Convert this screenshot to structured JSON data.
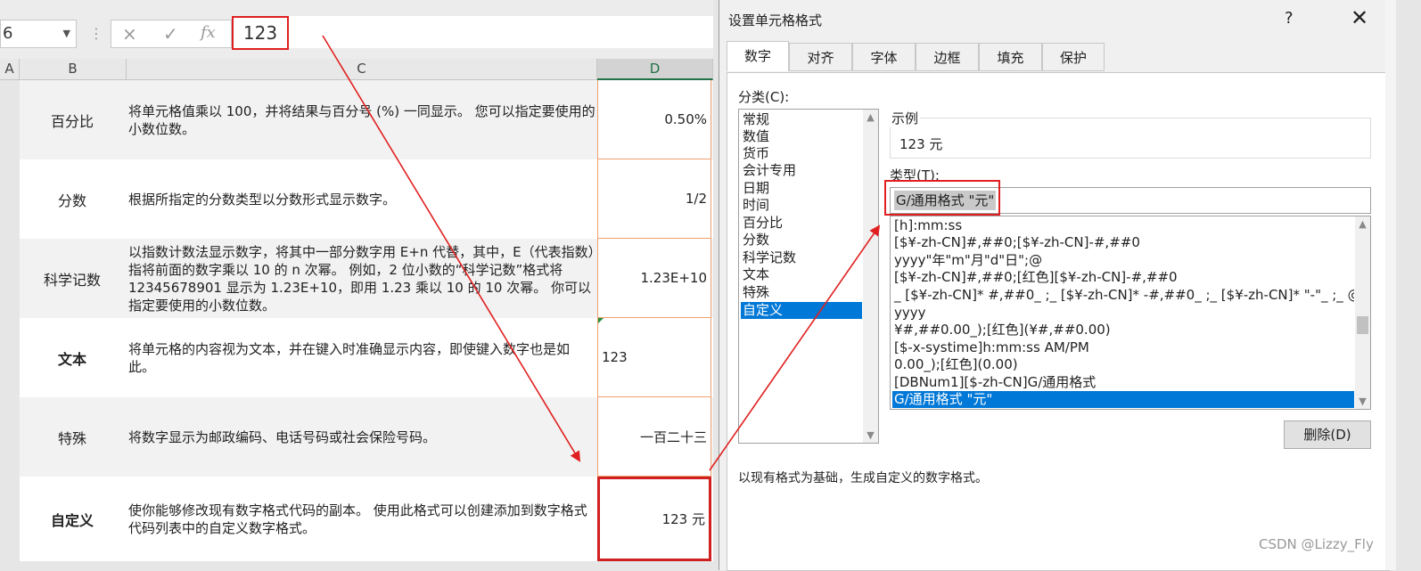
{
  "formula_bar": {
    "name_box": "6",
    "cancel_icon": "×",
    "enter_icon": "✓",
    "fx_label": "fx",
    "value": "123"
  },
  "columns": [
    "A",
    "B",
    "C",
    "D"
  ],
  "rows": [
    {
      "category": "百分比",
      "bold": false,
      "description": "将单元格值乘以 100，并将结果与百分号 (%) 一同显示。 您可以指定要使用的小数位数。",
      "value": "0.50%"
    },
    {
      "category": "分数",
      "bold": false,
      "description": "根据所指定的分数类型以分数形式显示数字。",
      "value": "1/2"
    },
    {
      "category": "科学记数",
      "bold": false,
      "description": "以指数计数法显示数字，将其中一部分数字用 E+n 代替，其中，E（代表指数）指将前面的数字乘以 10 的 n 次幂。 例如，2 位小数的“科学记数”格式将 12345678901 显示为 1.23E+10，即用 1.23 乘以 10 的 10 次幂。 你可以指定要使用的小数位数。",
      "value": "1.23E+10"
    },
    {
      "category": "文本",
      "bold": true,
      "description": "将单元格的内容视为文本，并在键入时准确显示内容，即使键入数字也是如此。",
      "value": "123"
    },
    {
      "category": "特殊",
      "bold": false,
      "description": "将数字显示为邮政编码、电话号码或社会保险号码。",
      "value": "一百二十三"
    },
    {
      "category": "自定义",
      "bold": true,
      "description": "使你能够修改现有数字格式代码的副本。 使用此格式可以创建添加到数字格式代码列表中的自定义数字格式。",
      "value": "123 元"
    }
  ],
  "dialog": {
    "title": "设置单元格格式",
    "help": "?",
    "close": "✕",
    "tabs": [
      "数字",
      "对齐",
      "字体",
      "边框",
      "填充",
      "保护"
    ],
    "active_tab": "数字",
    "category_label": "分类(C):",
    "categories": [
      "常规",
      "数值",
      "货币",
      "会计专用",
      "日期",
      "时间",
      "百分比",
      "分数",
      "科学记数",
      "文本",
      "特殊",
      "自定义"
    ],
    "selected_category": "自定义",
    "sample_label": "示例",
    "sample_value": "123 元",
    "type_label": "类型(T):",
    "type_value": "G/通用格式 \"元\"",
    "formats": [
      "[h]:mm:ss",
      "[$¥-zh-CN]#,##0;[$¥-zh-CN]-#,##0",
      "yyyy\"年\"m\"月\"d\"日\";@",
      "[$¥-zh-CN]#,##0;[红色][$¥-zh-CN]-#,##0",
      "_ [$¥-zh-CN]* #,##0_ ;_ [$¥-zh-CN]* -#,##0_ ;_ [$¥-zh-CN]* \"-\"_ ;_ @_",
      "yyyy",
      "¥#,##0.00_);[红色](¥#,##0.00)",
      "[$-x-systime]h:mm:ss AM/PM",
      "0.00_);[红色](0.00)",
      "[DBNum1][$-zh-CN]G/通用格式",
      "G/通用格式 \"元\""
    ],
    "selected_format": "G/通用格式 \"元\"",
    "delete_button": "删除(D)",
    "description": "以现有格式为基础，生成自定义的数字格式。"
  },
  "watermark": "CSDN @Lizzy_Fly",
  "colors": {
    "highlight": "#e02020",
    "selection": "#0078d7",
    "excel_green": "#217346"
  }
}
